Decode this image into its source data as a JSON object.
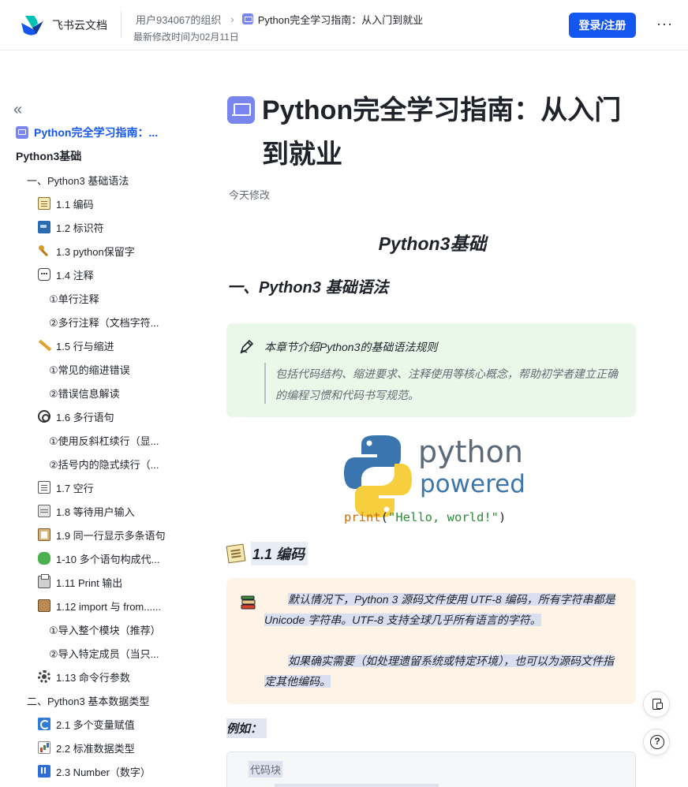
{
  "header": {
    "brand": "飞书云文档",
    "org": "用户934067的组织",
    "breadcrumb_doc": "Python完全学习指南：从入门到就业",
    "last_modified": "最新修改时间为02月11日",
    "login_label": "登录/注册",
    "more_label": "···"
  },
  "sidebar": {
    "collapse_label": "«",
    "items": [
      {
        "label": "Python完全学习指南：...",
        "icon": "doc-icon",
        "level": "active"
      },
      {
        "label": "Python3基础",
        "icon": "",
        "level": "h1"
      },
      {
        "label": "一、Python3 基础语法",
        "icon": "",
        "level": "h2"
      },
      {
        "label": "1.1 编码",
        "icon": "memo-icon",
        "level": "h3"
      },
      {
        "label": "1.2 标识符",
        "icon": "screen-icon",
        "level": "h3"
      },
      {
        "label": "1.3 python保留字",
        "icon": "key-icon",
        "level": "h3"
      },
      {
        "label": "1.4 注释",
        "icon": "speech-bubble-icon",
        "level": "h3"
      },
      {
        "label": "①单行注释",
        "icon": "",
        "level": "h4"
      },
      {
        "label": "②多行注释（文档字符...",
        "icon": "",
        "level": "h4"
      },
      {
        "label": "1.5 行与缩进",
        "icon": "ruler-icon",
        "level": "h3"
      },
      {
        "label": "①常见的缩进错误",
        "icon": "",
        "level": "h4"
      },
      {
        "label": "②错误信息解读",
        "icon": "",
        "level": "h4"
      },
      {
        "label": "1.6 多行语句",
        "icon": "paperclip-icon",
        "level": "h3"
      },
      {
        "label": "①使用反斜杠续行（显...",
        "icon": "",
        "level": "h4"
      },
      {
        "label": "②括号内的隐式续行（...",
        "icon": "",
        "level": "h4"
      },
      {
        "label": "1.7 空行",
        "icon": "page-icon",
        "level": "h3"
      },
      {
        "label": "1.8 等待用户输入",
        "icon": "keyboard-icon",
        "level": "h3"
      },
      {
        "label": "1.9 同一行显示多条语句",
        "icon": "clipboard-icon",
        "level": "h3"
      },
      {
        "label": "1-10 多个语句构成代...",
        "icon": "puzzle-icon",
        "level": "h3"
      },
      {
        "label": "1.11 Print 输出",
        "icon": "printer-icon",
        "level": "h3"
      },
      {
        "label": "1.12 import 与 from......",
        "icon": "package-icon",
        "level": "h3"
      },
      {
        "label": "①导入整个模块（推荐）",
        "icon": "",
        "level": "h4"
      },
      {
        "label": "②导入特定成员（当只...",
        "icon": "",
        "level": "h4"
      },
      {
        "label": "1.13 命令行参数",
        "icon": "gear-icon",
        "level": "h3"
      },
      {
        "label": "二、Python3 基本数据类型",
        "icon": "",
        "level": "h2"
      },
      {
        "label": "2.1 多个变量赋值",
        "icon": "cycle-icon",
        "level": "h3"
      },
      {
        "label": "2.2 标准数据类型",
        "icon": "bar-chart-icon",
        "level": "h3"
      },
      {
        "label": "2.3 Number（数字）",
        "icon": "numbers-icon",
        "level": "h3"
      }
    ]
  },
  "document": {
    "title": "Python完全学习指南：从入门到就业",
    "updated": "今天修改",
    "heading_center": "Python3基础",
    "section_heading": "一、Python3 基础语法",
    "callout_title": "本章节介绍Python3的基础语法规则",
    "callout_quote": "包括代码结构、缩进要求、注释使用等核心概念，帮助初学者建立正确的编程习惯和代码书写规范。",
    "image": {
      "logo_word_1": "python",
      "logo_word_2": "powered",
      "code_caption_fn": "print",
      "code_caption_paren_open": "(",
      "code_caption_str": "\"Hello, world!\"",
      "code_caption_paren_close": ")"
    },
    "subheading": "1.1 编码",
    "info_para_1": "默认情况下，Python 3 源码文件使用 UTF-8 编码，所有字符串都是 Unicode 字符串。UTF-8 支持全球几乎所有语言的字符。",
    "info_para_2": "如果确实需要（如处理遗留系统或特定环境），也可以为源码文件指定其他编码。",
    "example_label": "例如：",
    "code_block_label": "代码块"
  },
  "floating": {
    "help_label": "?"
  },
  "colors": {
    "accent": "#1456f0",
    "green_callout": "#eaf8ea",
    "orange_callout": "#fdf3e7",
    "doc_icon": "#7a86f0",
    "python_blue": "#3a75b0",
    "python_yellow": "#f7ce3e"
  }
}
